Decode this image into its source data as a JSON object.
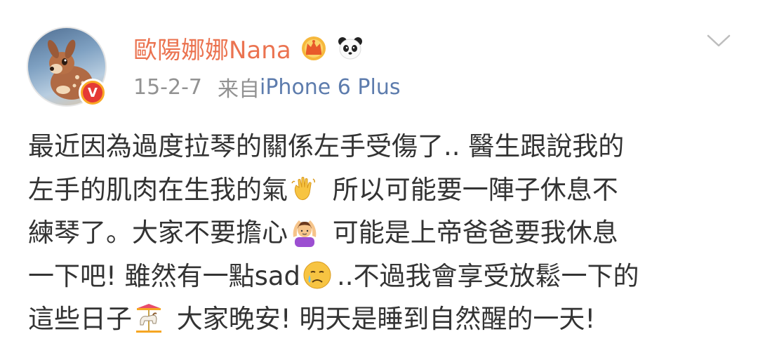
{
  "post": {
    "author": {
      "name": "歐陽娜娜Nana",
      "avatar_icon": "bambi-avatar",
      "verified_badge_text": "V",
      "badges": [
        "crown-icon",
        "panda-icon"
      ],
      "name_color": "#eb7350"
    },
    "timestamp": "15-2-7",
    "source_prefix": "来自",
    "source_device": "iPhone 6 Plus",
    "menu_icon": "chevron-down-icon",
    "text_segments": {
      "s1": "最近因為過度拉琴的關係左手受傷了.. 醫生跟說我的\n左手的肌肉在生我的氣",
      "s2": " 所以可能要一陣子休息不\n練琴了。大家不要擔心",
      "s3": " 可能是上帝爸爸要我休息\n一下吧! 雖然有一點sad",
      "s4": "..不過我會享受放鬆一下的\n這些日子",
      "s5": " 大家晚安! 明天是睡到自然醒的一天!"
    },
    "inline_emojis": [
      "waving-hand-emoji",
      "hands-on-head-emoji",
      "crying-face-emoji",
      "carousel-horse-emoji"
    ]
  },
  "colors": {
    "username": "#eb7350",
    "link": "#5d7cad",
    "meta": "#929292",
    "body_text": "#333333",
    "badge_orange": "#f9a825",
    "badge_red": "#e53935"
  }
}
